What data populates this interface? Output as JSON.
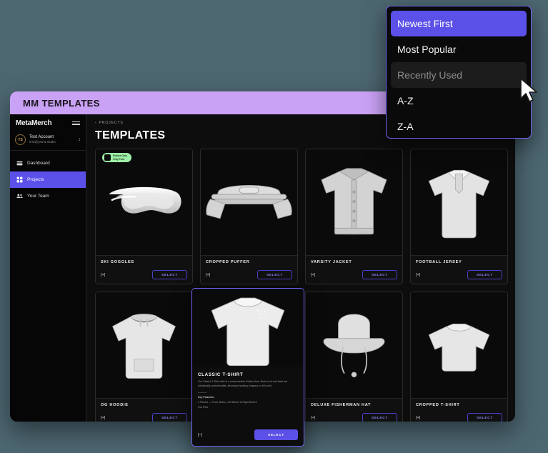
{
  "window": {
    "title": "MM TEMPLATES"
  },
  "sidebar": {
    "brand": "MetaMerch",
    "menu_icon": "hamburger-icon",
    "account": {
      "initials": "YS",
      "name": "Test Account",
      "email": "test@yama.studio",
      "switcher_icon": "chevron-up-down-icon"
    },
    "items": [
      {
        "label": "Dashboard",
        "icon": "dashboard-icon",
        "active": false
      },
      {
        "label": "Projects",
        "icon": "grid-icon",
        "active": true
      },
      {
        "label": "Your Team",
        "icon": "people-icon",
        "active": false
      }
    ]
  },
  "main": {
    "breadcrumb": "PROJECTS",
    "breadcrumb_icon": "chevron-left-icon",
    "page_title": "TEMPLATES",
    "select_label": "SELECT",
    "expand_label": "[+]",
    "collapse_label": "[–]",
    "badge": {
      "line1": "Roblox Only",
      "line2": "Only Print"
    },
    "cards": [
      {
        "title": "SKI GOGGLES",
        "art": "goggles",
        "badge": true
      },
      {
        "title": "CROPPED PUFFER",
        "art": "puffer",
        "badge": false
      },
      {
        "title": "VARSITY JACKET",
        "art": "varsity",
        "badge": false
      },
      {
        "title": "FOOTBALL JERSEY",
        "art": "polo",
        "badge": false
      },
      {
        "title": "OG HOODIE",
        "art": "hoodie",
        "badge": false
      },
      {
        "title": "CLASSIC T-SHIRT",
        "art": "tshirt",
        "badge": false
      },
      {
        "title": "DELUXE FISHERMAN HAT",
        "art": "bucket",
        "badge": false
      },
      {
        "title": "CROPPED T-SHIRT",
        "art": "croptee",
        "badge": false
      }
    ],
    "expanded": {
      "title": "CLASSIC T-SHIRT",
      "description": "Our Classic T-Shirt skin is a customizable Roblox item. Both front and back are individually customizable, allowing branding, imagery, or full print.",
      "key_features_label": "Key Features:",
      "features": [
        "4 Panels — Front, Back, Left Sleeve & Right Sleeve",
        "Full Print"
      ]
    }
  },
  "dropdown": {
    "options": [
      {
        "label": "Newest First",
        "state": "selected"
      },
      {
        "label": "Most Popular",
        "state": "normal"
      },
      {
        "label": "Recently Used",
        "state": "hovered"
      },
      {
        "label": "A-Z",
        "state": "normal"
      },
      {
        "label": "Z-A",
        "state": "normal"
      }
    ]
  },
  "colors": {
    "backdrop": "#4d6771",
    "titlebar": "#caa2f5",
    "accent": "#5b50e8",
    "badge_green": "#9ef0a8"
  }
}
